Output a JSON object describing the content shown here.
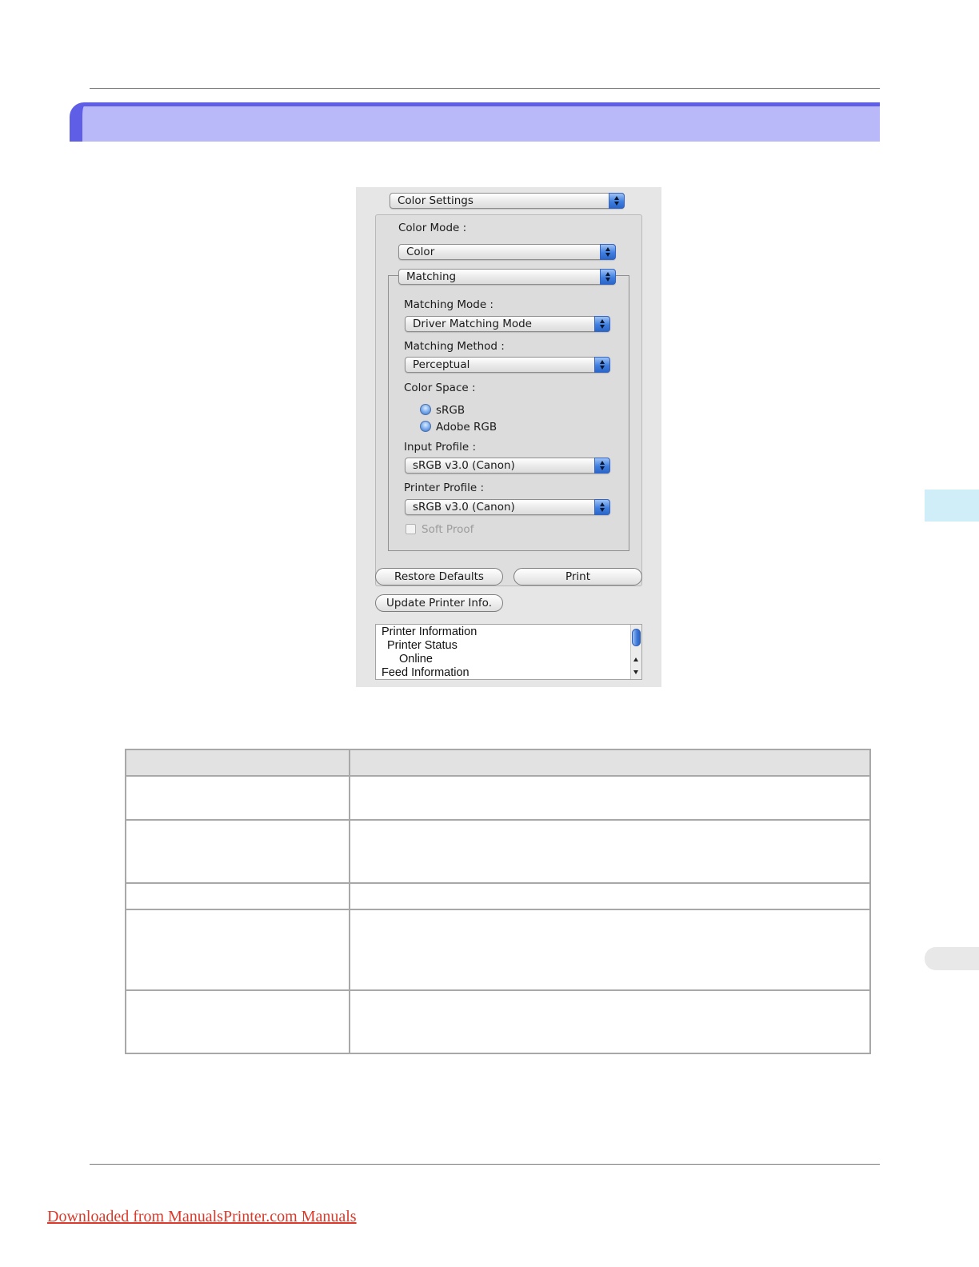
{
  "dialog": {
    "panel_popup": "Color Settings",
    "color_mode_label": "Color Mode :",
    "color_mode_value": "Color",
    "matching_group_popup": "Matching",
    "matching_mode_label": "Matching Mode :",
    "matching_mode_value": "Driver Matching Mode",
    "matching_method_label": "Matching Method :",
    "matching_method_value": "Perceptual",
    "color_space_label": "Color Space :",
    "color_space_options": [
      "sRGB",
      "Adobe RGB"
    ],
    "input_profile_label": "Input Profile :",
    "input_profile_value": "sRGB v3.0 (Canon)",
    "printer_profile_label": "Printer Profile :",
    "printer_profile_value": "sRGB v3.0 (Canon)",
    "soft_proof_label": "Soft Proof",
    "restore_defaults_button": "Restore Defaults",
    "print_button": "Print",
    "update_printer_info_button": "Update Printer Info.",
    "info_lines": [
      "Printer Information",
      "Printer Status",
      "Online",
      "Feed Information"
    ]
  },
  "footer": {
    "link_text": "Downloaded from ManualsPrinter.com Manuals"
  }
}
